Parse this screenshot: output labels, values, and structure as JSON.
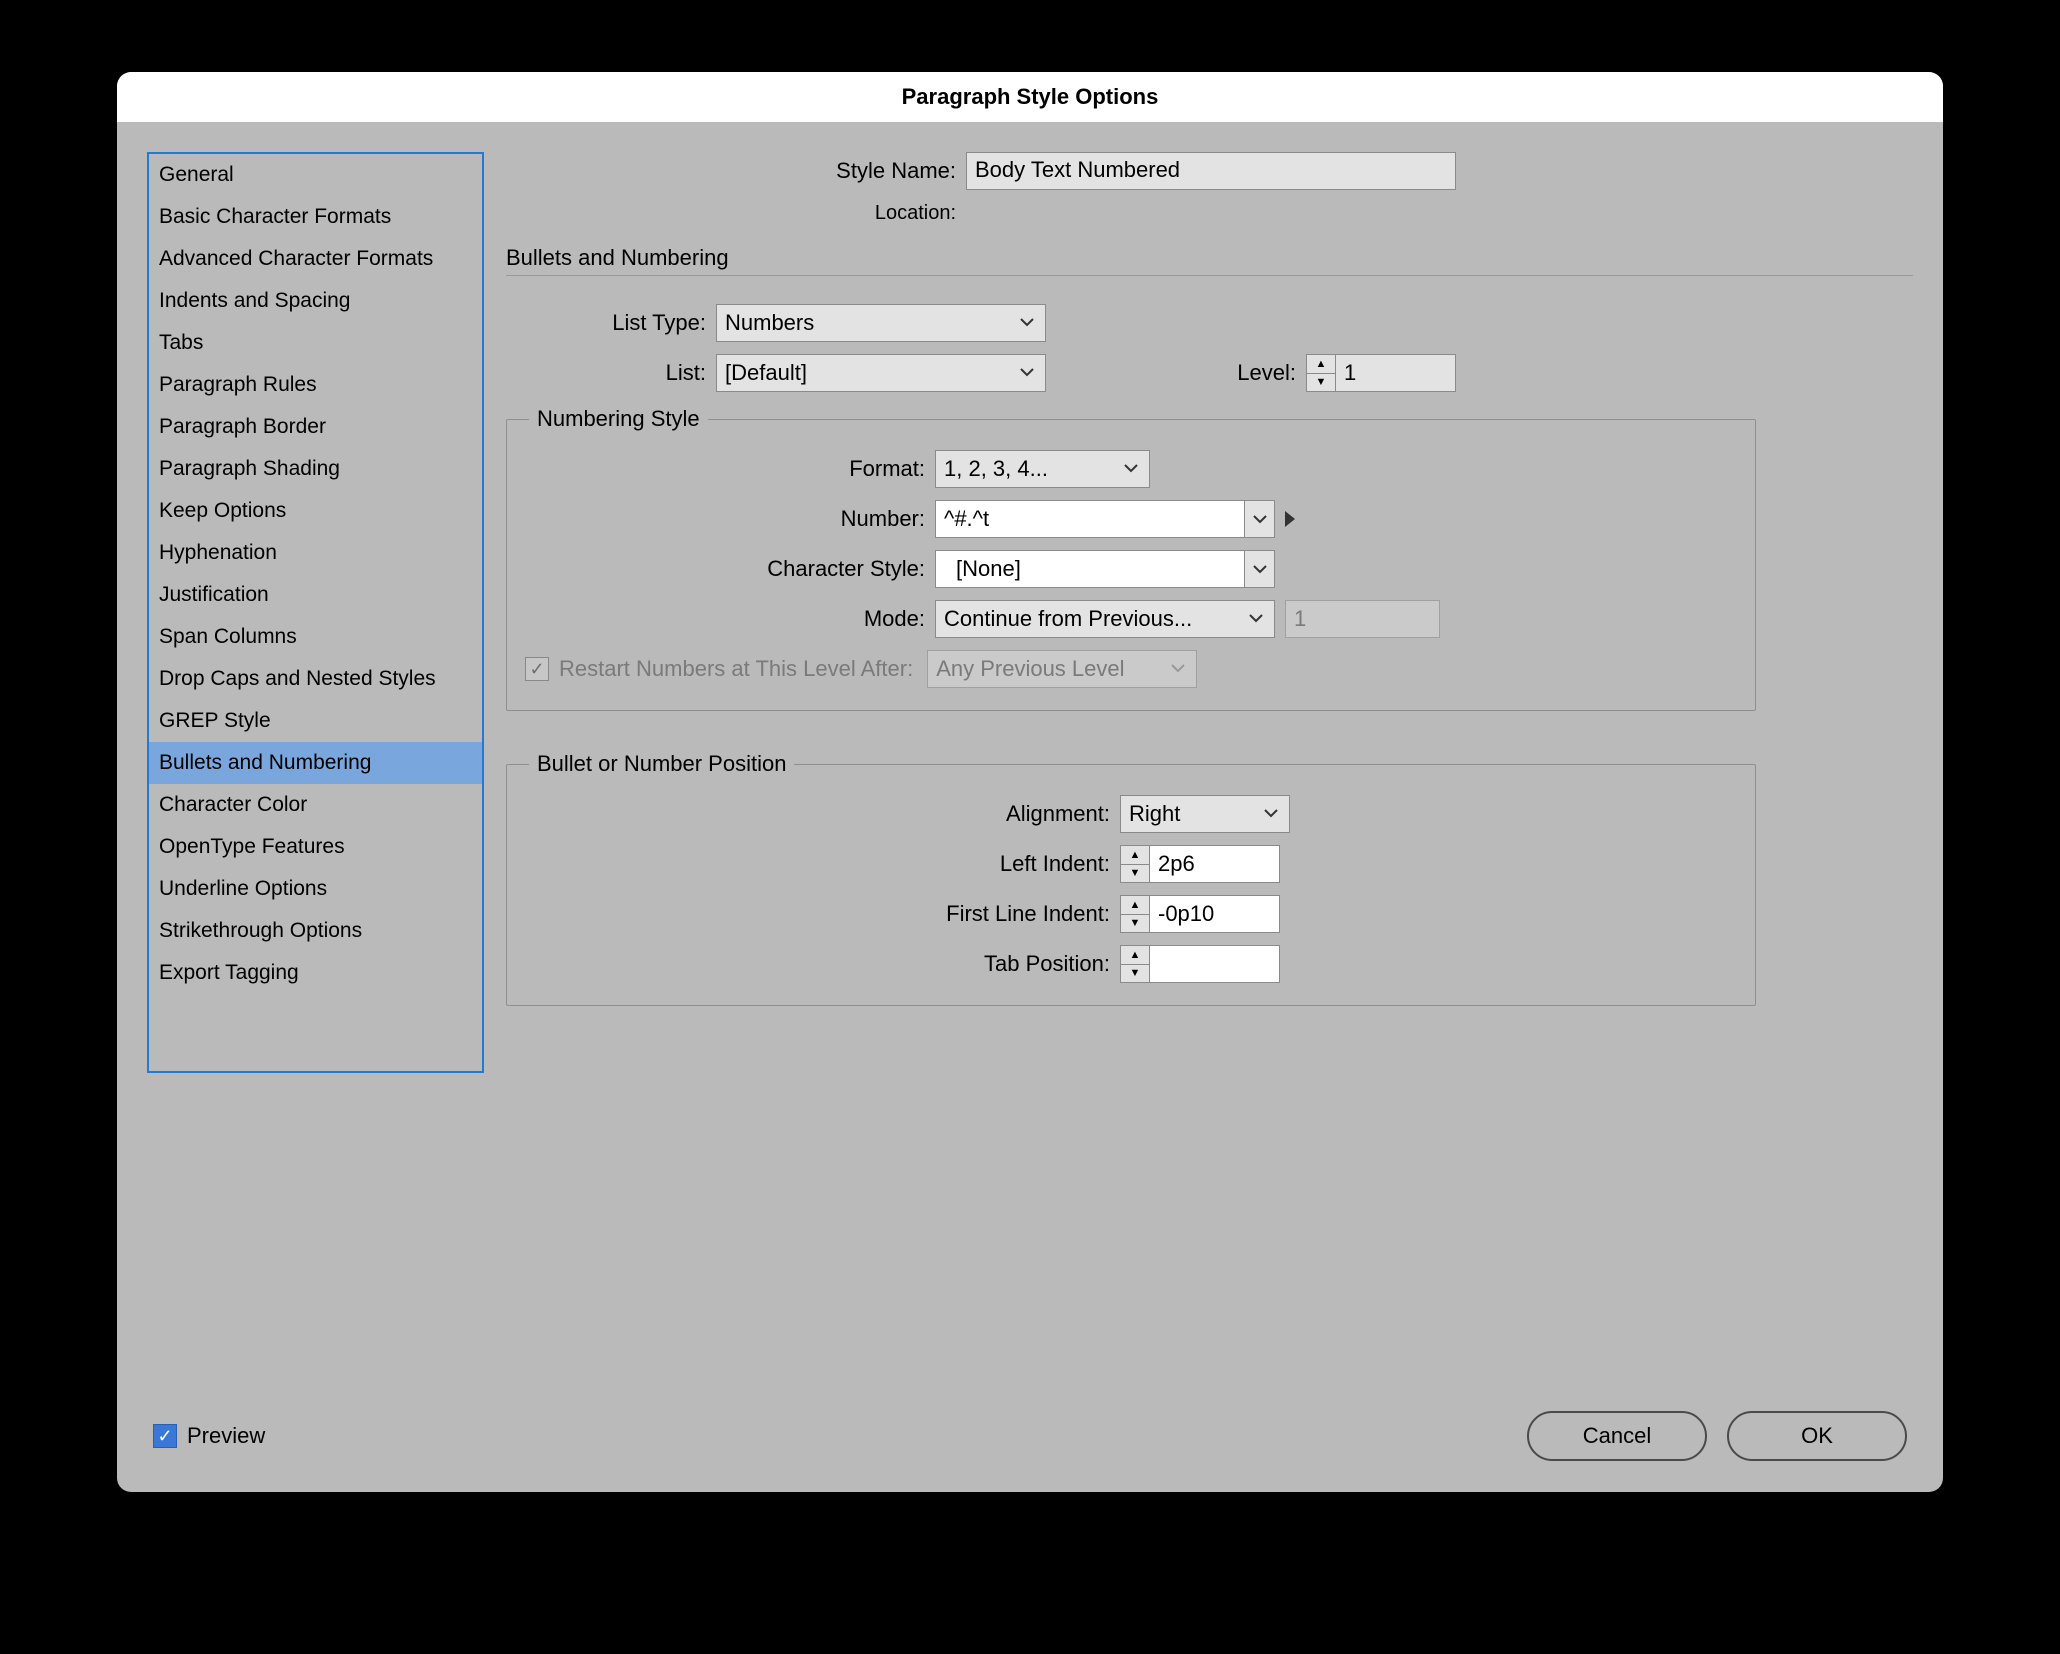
{
  "dialog_title": "Paragraph Style Options",
  "style_name_label": "Style Name:",
  "style_name_value": "Body Text Numbered",
  "location_label": "Location:",
  "section_title": "Bullets and Numbering",
  "sidebar": {
    "items": [
      "General",
      "Basic Character Formats",
      "Advanced Character Formats",
      "Indents and Spacing",
      "Tabs",
      "Paragraph Rules",
      "Paragraph Border",
      "Paragraph Shading",
      "Keep Options",
      "Hyphenation",
      "Justification",
      "Span Columns",
      "Drop Caps and Nested Styles",
      "GREP Style",
      "Bullets and Numbering",
      "Character Color",
      "OpenType Features",
      "Underline Options",
      "Strikethrough Options",
      "Export Tagging"
    ],
    "selected_index": 14
  },
  "list_type_label": "List Type:",
  "list_type_value": "Numbers",
  "list_label": "List:",
  "list_value": "[Default]",
  "level_label": "Level:",
  "level_value": "1",
  "numbering_style": {
    "legend": "Numbering Style",
    "format_label": "Format:",
    "format_value": "1, 2, 3, 4...",
    "number_label": "Number:",
    "number_value": "^#.^t",
    "charstyle_label": "Character Style:",
    "charstyle_value": "[None]",
    "mode_label": "Mode:",
    "mode_value": "Continue from Previous...",
    "mode_num": "1",
    "restart_label": "Restart Numbers at This Level After:",
    "restart_value": "Any Previous Level"
  },
  "position": {
    "legend": "Bullet or Number Position",
    "alignment_label": "Alignment:",
    "alignment_value": "Right",
    "left_indent_label": "Left Indent:",
    "left_indent_value": "2p6",
    "first_line_label": "First Line Indent:",
    "first_line_value": "-0p10",
    "tab_pos_label": "Tab Position:",
    "tab_pos_value": ""
  },
  "footer": {
    "preview_label": "Preview",
    "cancel": "Cancel",
    "ok": "OK"
  }
}
